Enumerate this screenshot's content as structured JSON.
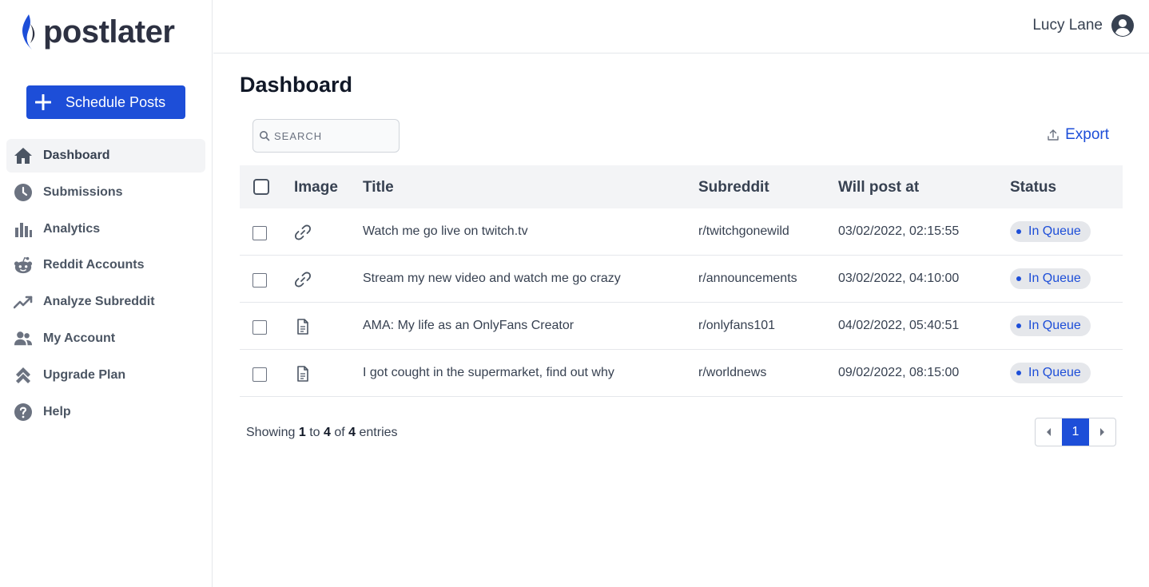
{
  "app": {
    "name": "postlater"
  },
  "sidebar": {
    "schedule_button": "Schedule Posts",
    "items": [
      {
        "label": "Dashboard",
        "icon": "home-icon",
        "active": true
      },
      {
        "label": "Submissions",
        "icon": "clock-icon",
        "active": false
      },
      {
        "label": "Analytics",
        "icon": "bar-chart-icon",
        "active": false
      },
      {
        "label": "Reddit Accounts",
        "icon": "reddit-icon",
        "active": false
      },
      {
        "label": "Analyze Subreddit",
        "icon": "trending-icon",
        "active": false
      },
      {
        "label": "My Account",
        "icon": "users-icon",
        "active": false
      },
      {
        "label": "Upgrade Plan",
        "icon": "upgrade-icon",
        "active": false
      },
      {
        "label": "Help",
        "icon": "help-icon",
        "active": false
      }
    ]
  },
  "header": {
    "user_name": "Lucy Lane"
  },
  "main": {
    "title": "Dashboard",
    "search_placeholder": "SEARCH",
    "export_label": "Export"
  },
  "table": {
    "columns": {
      "image": "Image",
      "title": "Title",
      "subreddit": "Subreddit",
      "post_at": "Will post at",
      "status": "Status"
    },
    "rows": [
      {
        "type": "link-icon",
        "title": "Watch me go live on twitch.tv",
        "subreddit": "r/twitchgonewild",
        "post_at": "03/02/2022, 02:15:55",
        "status": "In Queue"
      },
      {
        "type": "link-icon",
        "title": "Stream my new video and watch me go crazy",
        "subreddit": "r/announcements",
        "post_at": "03/02/2022, 04:10:00",
        "status": "In Queue"
      },
      {
        "type": "document-icon",
        "title": "AMA: My life as an OnlyFans Creator",
        "subreddit": "r/onlyfans101",
        "post_at": "04/02/2022, 05:40:51",
        "status": "In Queue"
      },
      {
        "type": "document-icon",
        "title": "I got cought in the supermarket, find out why",
        "subreddit": "r/worldnews",
        "post_at": "09/02/2022, 08:15:00",
        "status": "In Queue"
      }
    ]
  },
  "pagination": {
    "showing": "Showing",
    "from": "1",
    "to_word": "to",
    "to": "4",
    "of_word": "of",
    "total": "4",
    "entries": "entries",
    "current_page": "1"
  },
  "colors": {
    "accent": "#1d4ed8",
    "logo_flame": "#1d4ed8"
  }
}
